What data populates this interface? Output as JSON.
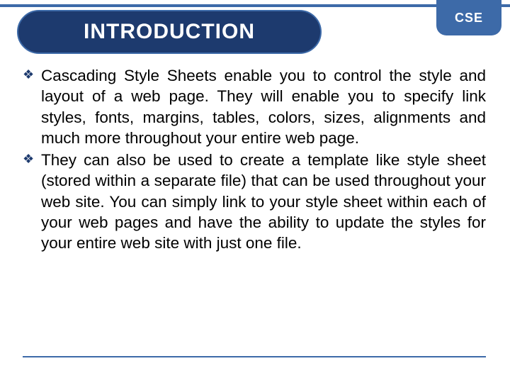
{
  "badge": "CSE",
  "title": "INTRODUCTION",
  "bullets": [
    "Cascading Style Sheets enable you to control the style and layout of a web page. They will enable you to specify link styles, fonts, margins, tables, colors, sizes, alignments and much more throughout your entire web page.",
    "They can also be used to create a template like style sheet (stored within a separate file) that can be used throughout your web site. You can simply link to your style sheet within each of your web pages and have the ability to update the styles for your entire web site with just one file."
  ]
}
